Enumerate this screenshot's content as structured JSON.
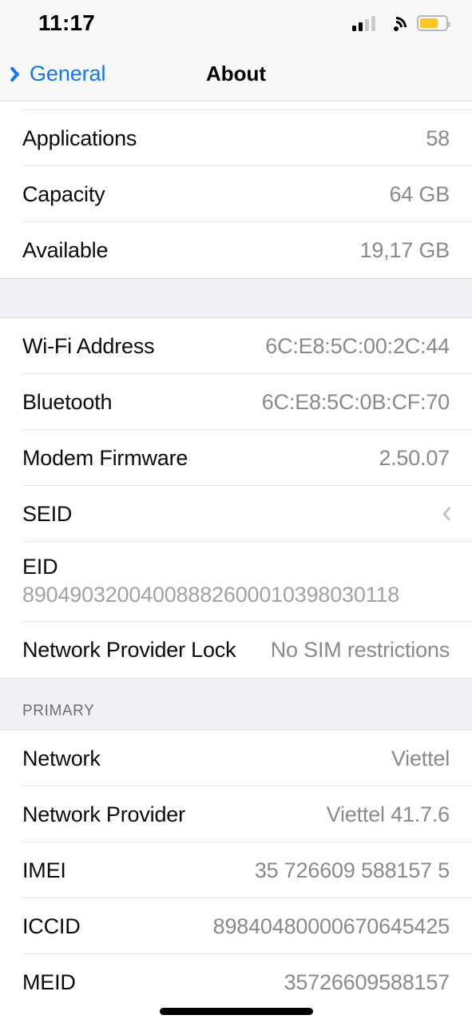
{
  "status_bar": {
    "time": "11:17",
    "signal_icon": "cellular-signal-icon",
    "signal_bars_filled": 2,
    "signal_bars_total": 4,
    "wifi_icon": "wifi-icon",
    "battery_icon": "battery-icon",
    "battery_level_percent": 70,
    "battery_color": "#fcc521"
  },
  "nav_bar": {
    "back_icon": "chevron-left-icon",
    "back_label": "General",
    "title": "About",
    "accent_color": "#1277f0"
  },
  "sections": [
    {
      "header": "",
      "rows": [
        {
          "label": "Applications",
          "value": "58"
        },
        {
          "label": "Capacity",
          "value": "64 GB"
        },
        {
          "label": "Available",
          "value": "19,17 GB"
        }
      ]
    },
    {
      "header": "",
      "rows": [
        {
          "label": "Wi-Fi Address",
          "value": "6C:E8:5C:00:2C:44"
        },
        {
          "label": "Bluetooth",
          "value": "6C:E8:5C:0B:CF:70"
        },
        {
          "label": "Modem Firmware",
          "value": "2.50.07"
        },
        {
          "label": "SEID",
          "value": "",
          "accessory": "chevron-right-icon"
        },
        {
          "label": "EID",
          "value": "89049032004008882600010398030118",
          "stacked": true
        },
        {
          "label": "Network Provider Lock",
          "value": "No SIM restrictions"
        }
      ]
    },
    {
      "header": "PRIMARY",
      "rows": [
        {
          "label": "Network",
          "value": "Viettel"
        },
        {
          "label": "Network Provider",
          "value": "Viettel 41.7.6"
        },
        {
          "label": "IMEI",
          "value": "35 726609 588157 5"
        },
        {
          "label": "ICCID",
          "value": "89840480000670645425"
        },
        {
          "label": "MEID",
          "value": "35726609588157"
        }
      ]
    }
  ],
  "home_indicator": "home-indicator"
}
